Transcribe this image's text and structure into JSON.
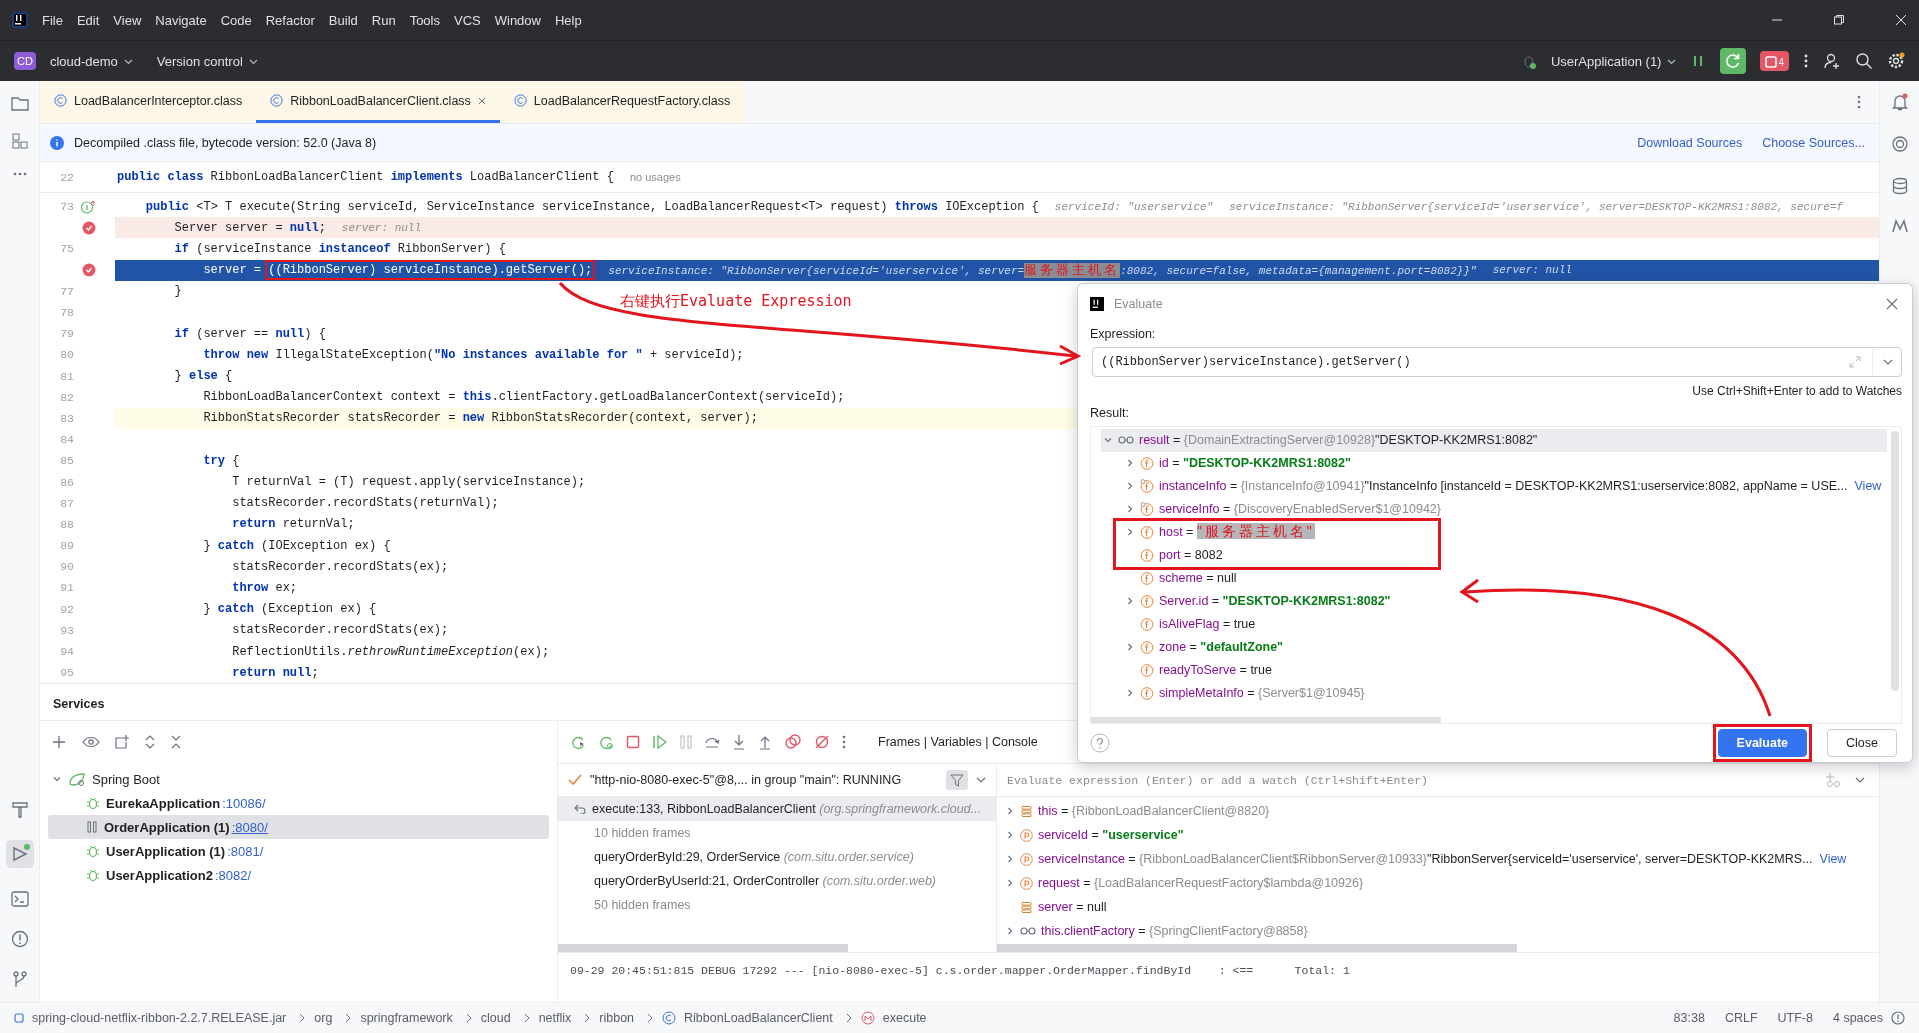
{
  "menu": [
    "File",
    "Edit",
    "View",
    "Navigate",
    "Code",
    "Refactor",
    "Build",
    "Run",
    "Tools",
    "VCS",
    "Window",
    "Help"
  ],
  "project": {
    "badge": "CD",
    "name": "cloud-demo"
  },
  "vcs": "Version control",
  "run_config": "UserApplication (1)",
  "stop_count": "4",
  "tabs": [
    {
      "label": "LoadBalancerInterceptor.class",
      "selected": false
    },
    {
      "label": "RibbonLoadBalancerClient.class",
      "selected": true
    },
    {
      "label": "LoadBalancerRequestFactory.class",
      "selected": false
    }
  ],
  "banner": {
    "text": "Decompiled .class file, bytecode version: 52.0 (Java 8)",
    "links": [
      "Download Sources",
      "Choose Sources..."
    ]
  },
  "code": {
    "header": {
      "no": "22",
      "text": "**public class** RibbonLoadBalancerClient **implements** LoadBalancerClient {",
      "hint": "no usages"
    },
    "lines": [
      {
        "no": "73",
        "kind": "method",
        "selected": false,
        "text": "    **public** <T> T execute(String serviceId, ServiceInstance serviceInstance, LoadBalancerRequest<T> request) **throws** IOException {",
        "hints": [
          {
            "text": "serviceId: \"userservice\""
          },
          {
            "text": "serviceInstance: \"RibbonServer{serviceId='userservice', server=DESKTOP-KK2MRS1:8082, secure=f"
          }
        ]
      },
      {
        "kind": "breakpoint",
        "selected": false,
        "text": "        Server server = **null**;",
        "hints": [
          {
            "text": "server: null"
          }
        ]
      },
      {
        "no": "75",
        "kind": "plain",
        "selected": false,
        "text": "        **if** (serviceInstance **instanceof** RibbonServer) {"
      },
      {
        "kind": "breakpoint",
        "selected": true,
        "text": "            server = ",
        "boxed": "((RibbonServer) serviceInstance).getServer();",
        "hints": [
          {
            "text": "serviceInstance: \"RibbonServer{serviceId='userservice', server=",
            "redacted": "服务器主机名",
            "text_after": ":8082, secure=false, metadata={management.port=8082}}\""
          },
          {
            "text": "server: null"
          }
        ]
      },
      {
        "no": "77",
        "kind": "plain",
        "selected": false,
        "text": "        }"
      },
      {
        "no": "78",
        "kind": "plain",
        "selected": false
      },
      {
        "no": "79",
        "kind": "plain",
        "selected": false,
        "text": "        **if** (server == **null**) {"
      },
      {
        "no": "80",
        "kind": "plain",
        "selected": false,
        "text": "            **throw new** IllegalStateException(**\"No instances available for \"** + serviceId);"
      },
      {
        "no": "81",
        "kind": "plain",
        "selected": false,
        "text": "        } **else** {"
      },
      {
        "no": "82",
        "kind": "plain",
        "selected": false,
        "text": "            RibbonLoadBalancerContext context = **this**.clientFactory.getLoadBalancerContext(serviceId);"
      },
      {
        "no": "83",
        "kind": "caret",
        "selected": false,
        "text": "            RibbonStatsRecorder statsRecorder = **new** RibbonStatsRecorder(context, server);"
      },
      {
        "no": "84",
        "kind": "plain",
        "selected": false
      },
      {
        "no": "85",
        "kind": "plain",
        "selected": false,
        "text": "            **try** {"
      },
      {
        "no": "86",
        "kind": "plain",
        "selected": false,
        "text": "                T returnVal = (T) request.apply(serviceInstance);"
      },
      {
        "no": "87",
        "kind": "plain",
        "selected": false,
        "text": "                statsRecorder.recordStats(returnVal);"
      },
      {
        "no": "88",
        "kind": "plain",
        "selected": false,
        "text": "                **return** returnVal;"
      },
      {
        "no": "89",
        "kind": "plain",
        "selected": false,
        "text": "            } **catch** (IOException ex) {"
      },
      {
        "no": "90",
        "kind": "plain",
        "selected": false,
        "text": "                statsRecorder.recordStats(ex);"
      },
      {
        "no": "91",
        "kind": "plain",
        "selected": false,
        "text": "                **throw** ex;"
      },
      {
        "no": "92",
        "kind": "plain",
        "selected": false,
        "text": "            } **catch** (Exception ex) {"
      },
      {
        "no": "93",
        "kind": "plain",
        "selected": false,
        "text": "                statsRecorder.recordStats(ex);"
      },
      {
        "no": "94",
        "kind": "plain",
        "selected": false,
        "text": "                ReflectionUtils.*rethrowRuntimeException*(ex);"
      },
      {
        "no": "95",
        "kind": "plain",
        "selected": false,
        "text": "                **return null**;"
      }
    ]
  },
  "annotation_label": "右键执行Evaluate Expression",
  "services": {
    "title": "Services",
    "root": {
      "label": "Spring Boot",
      "expanded": true,
      "children": [
        {
          "name": "EurekaApplication",
          "port": ":10086/",
          "kind": "running",
          "selected": false
        },
        {
          "name": "OrderApplication (1)",
          "port": ":8080/",
          "kind": "paused",
          "selected": true
        },
        {
          "name": "UserApplication (1)",
          "port": ":8081/",
          "kind": "running",
          "selected": false
        },
        {
          "name": "UserApplication2",
          "port": ":8082/",
          "kind": "running",
          "selected": false
        }
      ]
    }
  },
  "debugger": {
    "layout_tabs": "Frames | Variables | Console",
    "thread": "\"http-nio-8080-exec-5\"@8,... in group \"main\": RUNNING",
    "frames": [
      {
        "kind": "frame",
        "method": "execute:133, RibbonLoadBalancerClient",
        "pkg": "(org.springframework.cloud...",
        "selected": true
      },
      {
        "kind": "hidden",
        "method": "10 hidden frames",
        "selected": false
      },
      {
        "kind": "frame",
        "method": "queryOrderById:29, OrderService",
        "pkg": "(com.situ.order.service)",
        "selected": false
      },
      {
        "kind": "frame",
        "method": "queryOrderByUserId:21, OrderController",
        "pkg": "(com.situ.order.web)",
        "selected": false
      },
      {
        "kind": "hidden",
        "method": "50 hidden frames",
        "selected": false
      }
    ],
    "watch_placeholder": "Evaluate expression (Enter) or add a watch (Ctrl+Shift+Enter)",
    "variables": [
      {
        "kind": "local",
        "name": "this",
        "operator": "=",
        "type": "{RibbonLoadBalancerClient@8820}",
        "expandable": true
      },
      {
        "kind": "param",
        "name": "serviceId",
        "operator": "=",
        "value": "\"userservice\"",
        "string": true,
        "expandable": true
      },
      {
        "kind": "param",
        "name": "serviceInstance",
        "operator": "=",
        "type": "{RibbonLoadBalancerClient$RibbonServer@10933}",
        "value": "\"RibbonServer{serviceId='userservice', server=DESKTOP-KK2MRS...",
        "string": false,
        "link": "View",
        "expandable": true
      },
      {
        "kind": "param",
        "name": "request",
        "operator": "=",
        "type": "{LoadBalancerRequestFactory$lambda@10926}",
        "expandable": true
      },
      {
        "kind": "local",
        "name": "server",
        "operator": "=",
        "value": "null",
        "string": false,
        "expandable": false
      },
      {
        "kind": "watch",
        "name": "this.clientFactory",
        "operator": "=",
        "type": "{SpringClientFactory@8858}",
        "expandable": true
      }
    ],
    "console_line": "09-29 20:45:51:815 DEBUG 17292 --- [nio-8080-exec-5] c.s.order.mapper.OrderMapper.findById    : <==      Total: 1"
  },
  "dialog": {
    "title": "Evaluate",
    "expression_label": "Expression:",
    "expression": "((RibbonServer)serviceInstance).getServer()",
    "hint": "Use Ctrl+Shift+Enter to add to Watches",
    "result_label": "Result:",
    "result": {
      "kind": "watch",
      "name": "result",
      "operator": "=",
      "type": "{DomainExtractingServer@10928}",
      "value": "\"DESKTOP-KK2MRS1:8082\"",
      "string": false,
      "expanded": true,
      "children": [
        {
          "kind": "field",
          "name": "id",
          "operator": "=",
          "value": "\"DESKTOP-KK2MRS1:8082\"",
          "string": true,
          "expandable": true,
          "annotated": false
        },
        {
          "kind": "static-field",
          "name": "instanceInfo",
          "operator": "=",
          "type": "{InstanceInfo@10941}",
          "value": "\"InstanceInfo [instanceId = DESKTOP-KK2MRS1:userservice:8082, appName = USE...",
          "string": false,
          "link": "View",
          "expandable": true,
          "annotated": false
        },
        {
          "kind": "static-field",
          "name": "serviceInfo",
          "operator": "=",
          "type": "{DiscoveryEnabledServer$1@10942}",
          "expandable": true,
          "annotated": false
        },
        {
          "kind": "field",
          "name": "host",
          "operator": "=",
          "value": "\"服务器主机名\"",
          "redacted": true,
          "expandable": true,
          "annotated": true
        },
        {
          "kind": "field",
          "name": "port",
          "operator": "=",
          "value": "8082",
          "string": false,
          "expandable": false,
          "annotated": true
        },
        {
          "kind": "field",
          "name": "scheme",
          "operator": "=",
          "value": "null",
          "string": false,
          "expandable": false,
          "annotated": false
        },
        {
          "kind": "field",
          "name": "Server.id",
          "operator": "=",
          "value": "\"DESKTOP-KK2MRS1:8082\"",
          "string": true,
          "expandable": true,
          "annotated": false
        },
        {
          "kind": "field",
          "name": "isAliveFlag",
          "operator": "=",
          "value": "true",
          "string": false,
          "expandable": false,
          "annotated": false
        },
        {
          "kind": "field",
          "name": "zone",
          "operator": "=",
          "value": "\"defaultZone\"",
          "string": true,
          "expandable": true,
          "annotated": false
        },
        {
          "kind": "field",
          "name": "readyToServe",
          "operator": "=",
          "value": "true",
          "string": false,
          "expandable": false,
          "annotated": false
        },
        {
          "kind": "field",
          "name": "simpleMetaInfo",
          "operator": "=",
          "type": "{Server$1@10945}",
          "expandable": true,
          "annotated": false
        }
      ]
    },
    "buttons": [
      {
        "label": "Evaluate",
        "primary": true,
        "annotated": true
      },
      {
        "label": "Close",
        "primary": false,
        "annotated": false
      }
    ]
  },
  "breadcrumbs": [
    {
      "kind": "jar",
      "label": "spring-cloud-netflix-ribbon-2.2.7.RELEASE.jar"
    },
    {
      "kind": "package",
      "label": "org"
    },
    {
      "kind": "package",
      "label": "springframework"
    },
    {
      "kind": "package",
      "label": "cloud"
    },
    {
      "kind": "package",
      "label": "netflix"
    },
    {
      "kind": "package",
      "label": "ribbon"
    },
    {
      "kind": "class",
      "label": "RibbonLoadBalancerClient"
    },
    {
      "kind": "method",
      "label": "execute"
    }
  ],
  "status": [
    "83:38",
    "CRLF",
    "UTF-8",
    "4 spaces"
  ]
}
